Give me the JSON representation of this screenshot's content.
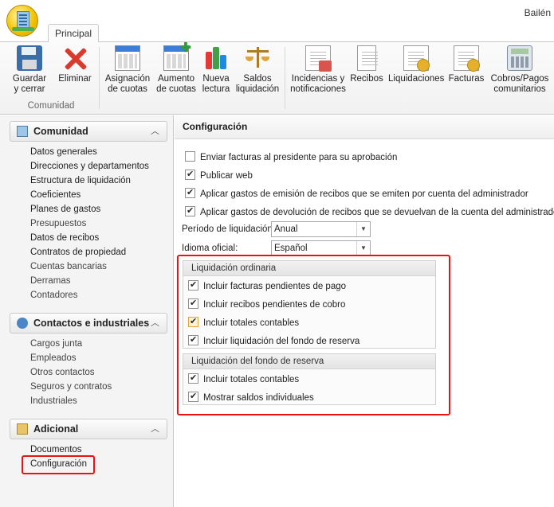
{
  "window": {
    "title": "Bailén"
  },
  "tabs": {
    "principal": "Principal"
  },
  "ribbon": {
    "group_label": "Comunidad",
    "buttons": [
      {
        "label": "Guardar y cerrar",
        "icon": "save-icon"
      },
      {
        "label": "Eliminar",
        "icon": "delete-icon"
      },
      {
        "label": "Asignación de cuotas",
        "icon": "calendar-icon"
      },
      {
        "label": "Aumento de cuotas",
        "icon": "calendar-add-icon"
      },
      {
        "label": "Nueva lectura",
        "icon": "bar-chart-icon"
      },
      {
        "label": "Saldos liquidación",
        "icon": "scale-icon"
      },
      {
        "label": "Incidencias y notificaciones",
        "icon": "notification-icon"
      },
      {
        "label": "Recibos",
        "icon": "receipt-icon"
      },
      {
        "label": "Liquidaciones",
        "icon": "liquidation-icon"
      },
      {
        "label": "Facturas",
        "icon": "invoice-icon"
      },
      {
        "label": "Cobros/Pagos comunitarios",
        "icon": "calculator-icon"
      }
    ]
  },
  "nav": {
    "sections": [
      {
        "title": "Comunidad",
        "items": [
          "Datos generales",
          "Direcciones y departamentos",
          "Estructura de liquidación",
          "Coeficientes",
          "Planes de gastos",
          "Presupuestos",
          "Datos de recibos",
          "Contratos de propiedad",
          "Cuentas bancarias",
          "Derramas",
          "Contadores"
        ]
      },
      {
        "title": "Contactos e industriales",
        "items": [
          "Cargos junta",
          "Empleados",
          "Otros contactos",
          "Seguros y contratos",
          "Industriales"
        ]
      },
      {
        "title": "Adicional",
        "items": [
          "Documentos",
          "Configuración"
        ]
      }
    ]
  },
  "main": {
    "header": "Configuración",
    "checks": [
      {
        "label": "Enviar facturas al presidente para su aprobación",
        "checked": false
      },
      {
        "label": "Publicar web",
        "checked": true
      },
      {
        "label": "Aplicar gastos de emisión de recibos que se emiten por cuenta del administrador",
        "checked": true
      },
      {
        "label": "Aplicar gastos de devolución de recibos que se devuelvan de la cuenta del administrador",
        "checked": true
      }
    ],
    "periodo": {
      "label": "Período de liquidación:",
      "value": "Anual"
    },
    "idioma": {
      "label": "Idioma oficial:",
      "value": "Español"
    },
    "group_ordinaria": {
      "title": "Liquidación ordinaria",
      "checks": [
        {
          "label": "Incluir facturas pendientes de pago",
          "checked": true
        },
        {
          "label": "Incluir recibos pendientes de cobro",
          "checked": true
        },
        {
          "label": "Incluir totales contables",
          "checked": true,
          "hover": true
        },
        {
          "label": "Incluir liquidación del fondo de reserva",
          "checked": true
        }
      ]
    },
    "group_fondo": {
      "title": "Liquidación del fondo de reserva",
      "checks": [
        {
          "label": "Incluir totales contables",
          "checked": true
        },
        {
          "label": "Mostrar saldos individuales",
          "checked": true
        }
      ]
    }
  },
  "colors": {
    "highlight_frame": "#ee1111",
    "accent_blue": "#3b7dd8"
  }
}
